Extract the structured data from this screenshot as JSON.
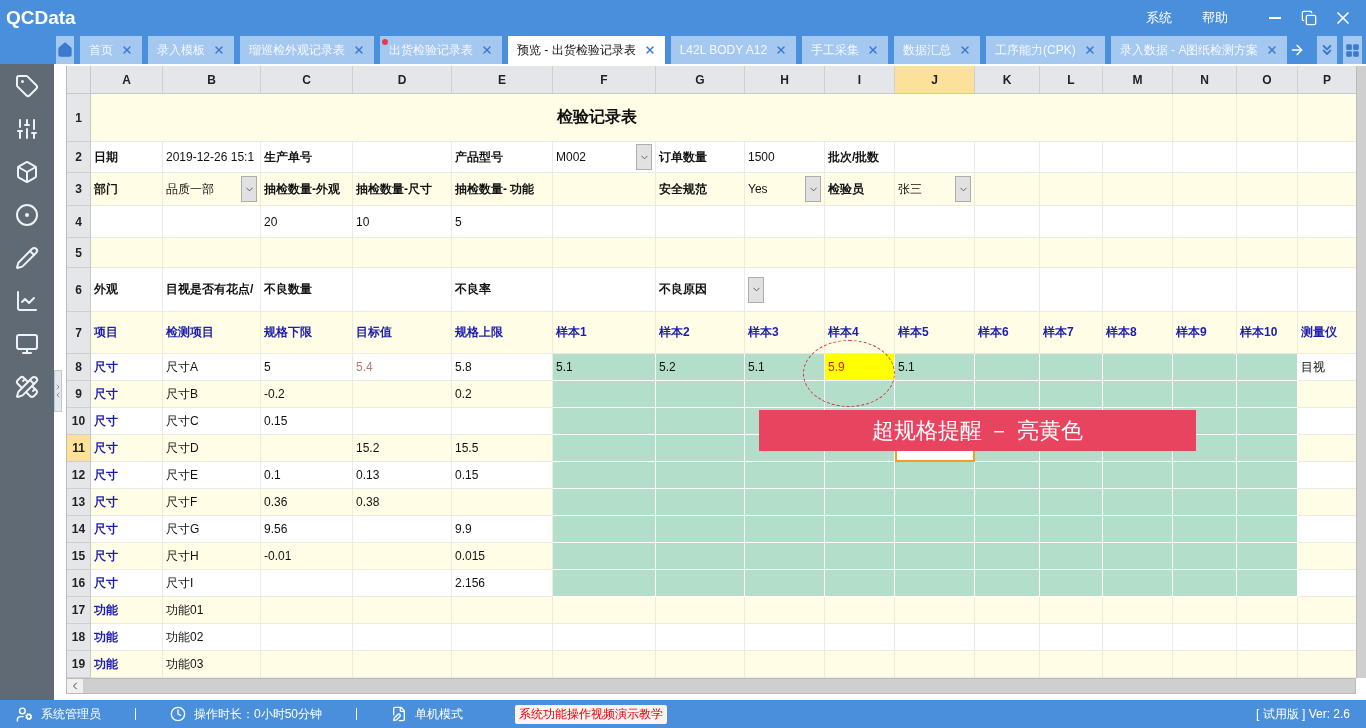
{
  "app": {
    "title": "QCData",
    "menu": [
      "系统",
      "帮助"
    ]
  },
  "tabs": [
    {
      "label": "首页",
      "selected": false,
      "modified": false
    },
    {
      "label": "录入模板",
      "selected": false,
      "modified": false
    },
    {
      "label": "瑠巡检外观记录表",
      "selected": false,
      "modified": false
    },
    {
      "label": "出货检验记录表",
      "selected": false,
      "modified": true
    },
    {
      "label": "预览 - 出货检验记录表",
      "selected": true,
      "modified": false
    },
    {
      "label": "L42L BODY A12",
      "selected": false,
      "modified": false
    },
    {
      "label": "手工采集",
      "selected": false,
      "modified": false
    },
    {
      "label": "数据汇总",
      "selected": false,
      "modified": false
    },
    {
      "label": "工序能力(CPK)",
      "selected": false,
      "modified": false
    },
    {
      "label": "录入数据 - A图纸检测方案",
      "selected": false,
      "modified": false
    }
  ],
  "sheet": {
    "columns": [
      {
        "label": "A",
        "selected": false
      },
      {
        "label": "B",
        "selected": false
      },
      {
        "label": "C",
        "selected": false
      },
      {
        "label": "D",
        "selected": false
      },
      {
        "label": "E",
        "selected": false
      },
      {
        "label": "F",
        "selected": false
      },
      {
        "label": "G",
        "selected": false
      },
      {
        "label": "H",
        "selected": false
      },
      {
        "label": "I",
        "selected": false
      },
      {
        "label": "J",
        "selected": true
      },
      {
        "label": "K",
        "selected": false
      },
      {
        "label": "L",
        "selected": false
      },
      {
        "label": "M",
        "selected": false
      },
      {
        "label": "N",
        "selected": false
      },
      {
        "label": "O",
        "selected": false
      },
      {
        "label": "P",
        "selected": false
      }
    ],
    "rows": [
      {
        "label": "1",
        "selected": false,
        "kind": "form",
        "cells": [
          {
            "text": "检验记录表",
            "kind": "title"
          }
        ]
      },
      {
        "label": "2",
        "selected": false,
        "kind": "form",
        "cells": [
          {
            "text": "日期",
            "kind": "label"
          },
          {
            "text": "2019-12-26 15:1",
            "kind": "value"
          },
          {
            "text": "生产单号",
            "kind": "label"
          },
          {},
          {
            "text": "产品型号",
            "kind": "label"
          },
          {
            "text": "M002",
            "kind": "value",
            "dropdown": true
          },
          {
            "text": "订单数量",
            "kind": "label"
          },
          {
            "text": "1500",
            "kind": "value"
          },
          {
            "text": "批次/批数",
            "kind": "label"
          }
        ]
      },
      {
        "label": "3",
        "selected": false,
        "kind": "form",
        "cells": [
          {
            "text": "部门",
            "kind": "label"
          },
          {
            "text": "品质一部",
            "kind": "value",
            "dropdown": true
          },
          {
            "text": "抽检数量-外观",
            "kind": "label"
          },
          {
            "text": "抽检数量-尺寸",
            "kind": "label"
          },
          {
            "text": "抽检数量-  功能",
            "kind": "label"
          },
          {},
          {
            "text": "安全规范",
            "kind": "label"
          },
          {
            "text": "Yes",
            "kind": "value",
            "dropdown": true
          },
          {
            "text": "检验员",
            "kind": "label"
          },
          {
            "text": "张三",
            "kind": "value",
            "dropdown": true
          }
        ]
      },
      {
        "label": "4",
        "selected": false,
        "kind": "form",
        "cells": [
          {},
          {},
          {
            "text": "20",
            "kind": "value"
          },
          {
            "text": "10",
            "kind": "value"
          },
          {
            "text": "5",
            "kind": "value"
          }
        ]
      },
      {
        "label": "5",
        "selected": false,
        "kind": "form"
      },
      {
        "label": "6",
        "selected": false,
        "kind": "form",
        "cells": [
          {
            "text": "外观",
            "kind": "label"
          },
          {
            "text": "目视是否有花点/",
            "kind": "label"
          },
          {
            "text": "不良数量",
            "kind": "label"
          },
          {},
          {
            "text": "不良率",
            "kind": "label"
          },
          {},
          {
            "text": "不良原因",
            "kind": "label"
          },
          {
            "kind": "value",
            "dropdown": true
          }
        ]
      },
      {
        "label": "7",
        "selected": false,
        "kind": "form",
        "cells": [
          {
            "text": "项目",
            "kind": "heading"
          },
          {
            "text": "检测项目",
            "kind": "heading"
          },
          {
            "text": "规格下限",
            "kind": "heading"
          },
          {
            "text": "目标值",
            "kind": "heading"
          },
          {
            "text": "规格上限",
            "kind": "heading"
          },
          {
            "text": "样本1",
            "kind": "heading"
          },
          {
            "text": "样本2",
            "kind": "heading"
          },
          {
            "text": "样本3",
            "kind": "heading"
          },
          {
            "text": "样本4",
            "kind": "heading"
          },
          {
            "text": "样本5",
            "kind": "heading"
          },
          {
            "text": "样本6",
            "kind": "heading"
          },
          {
            "text": "样本7",
            "kind": "heading"
          },
          {
            "text": "样本8",
            "kind": "heading"
          },
          {
            "text": "样本9",
            "kind": "heading"
          },
          {
            "text": "样本10",
            "kind": "heading"
          },
          {
            "text": "测量仪",
            "kind": "heading"
          }
        ]
      },
      {
        "label": "8",
        "selected": false,
        "kind": "measure",
        "cells": [
          {
            "text": "尺寸",
            "kind": "heading"
          },
          {
            "text": "尺寸A",
            "kind": "value"
          },
          {
            "text": "5",
            "kind": "value"
          },
          {
            "text": "5.4",
            "kind": "target"
          },
          {
            "text": "5.8",
            "kind": "value"
          },
          {
            "text": "5.1",
            "kind": "value",
            "flagged": false
          },
          {
            "text": "5.2",
            "kind": "value",
            "flagged": false
          },
          {
            "text": "5.1",
            "kind": "value",
            "flagged": false
          },
          {
            "text": "5.9",
            "kind": "value",
            "flagged": true
          },
          {
            "text": "5.1",
            "kind": "value",
            "flagged": false
          },
          {},
          {},
          {},
          {},
          {},
          {
            "text": "目视",
            "kind": "value"
          }
        ]
      },
      {
        "label": "9",
        "selected": false,
        "kind": "measure",
        "cells": [
          {
            "text": "尺寸",
            "kind": "heading"
          },
          {
            "text": "尺寸B",
            "kind": "value"
          },
          {
            "text": "-0.2",
            "kind": "value"
          },
          {},
          {
            "text": "0.2",
            "kind": "value"
          }
        ]
      },
      {
        "label": "10",
        "selected": false,
        "kind": "measure",
        "cells": [
          {
            "text": "尺寸",
            "kind": "heading"
          },
          {
            "text": "尺寸C",
            "kind": "value"
          },
          {
            "text": "0.15",
            "kind": "value"
          }
        ]
      },
      {
        "label": "11",
        "selected": true,
        "kind": "measure",
        "cells": [
          {
            "text": "尺寸",
            "kind": "heading"
          },
          {
            "text": "尺寸D",
            "kind": "value"
          },
          {},
          {
            "text": "15.2",
            "kind": "value"
          },
          {
            "text": "15.5",
            "kind": "value"
          }
        ]
      },
      {
        "label": "12",
        "selected": false,
        "kind": "measure",
        "cells": [
          {
            "text": "尺寸",
            "kind": "heading"
          },
          {
            "text": "尺寸E",
            "kind": "value"
          },
          {
            "text": "0.1",
            "kind": "value"
          },
          {
            "text": "0.13",
            "kind": "value"
          },
          {
            "text": "0.15",
            "kind": "value"
          }
        ]
      },
      {
        "label": "13",
        "selected": false,
        "kind": "measure",
        "cells": [
          {
            "text": "尺寸",
            "kind": "heading"
          },
          {
            "text": "尺寸F",
            "kind": "value"
          },
          {
            "text": "0.36",
            "kind": "value"
          },
          {
            "text": "0.38",
            "kind": "value"
          }
        ]
      },
      {
        "label": "14",
        "selected": false,
        "kind": "measure",
        "cells": [
          {
            "text": "尺寸",
            "kind": "heading"
          },
          {
            "text": "尺寸G",
            "kind": "value"
          },
          {
            "text": "9.56",
            "kind": "value"
          },
          {},
          {
            "text": "9.9",
            "kind": "value"
          }
        ]
      },
      {
        "label": "15",
        "selected": false,
        "kind": "measure",
        "cells": [
          {
            "text": "尺寸",
            "kind": "heading"
          },
          {
            "text": "尺寸H",
            "kind": "value"
          },
          {
            "text": "-0.01",
            "kind": "value"
          },
          {},
          {
            "text": "0.015",
            "kind": "value"
          }
        ]
      },
      {
        "label": "16",
        "selected": false,
        "kind": "measure",
        "cells": [
          {
            "text": "尺寸",
            "kind": "heading"
          },
          {
            "text": "尺寸I",
            "kind": "value"
          },
          {},
          {},
          {
            "text": "2.156",
            "kind": "value"
          }
        ]
      },
      {
        "label": "17",
        "selected": false,
        "kind": "function",
        "cells": [
          {
            "text": "功能",
            "kind": "heading"
          },
          {
            "text": "功能01",
            "kind": "value"
          }
        ]
      },
      {
        "label": "18",
        "selected": false,
        "kind": "function",
        "cells": [
          {
            "text": "功能",
            "kind": "heading"
          },
          {
            "text": "功能02",
            "kind": "value"
          }
        ]
      },
      {
        "label": "19",
        "selected": false,
        "kind": "function",
        "cells": [
          {
            "text": "功能",
            "kind": "heading"
          },
          {
            "text": "功能03",
            "kind": "value"
          }
        ]
      }
    ],
    "callout": {
      "text": "超规格提醒 － 亮黄色"
    }
  },
  "status_bar": {
    "user": "系统管理员",
    "duration": "操作时长：0小时50分钟",
    "mode": "单机模式",
    "tutorial_link": "系统功能操作视频演示教学",
    "version": "[ 试用版 ] Ver: 2.6"
  }
}
